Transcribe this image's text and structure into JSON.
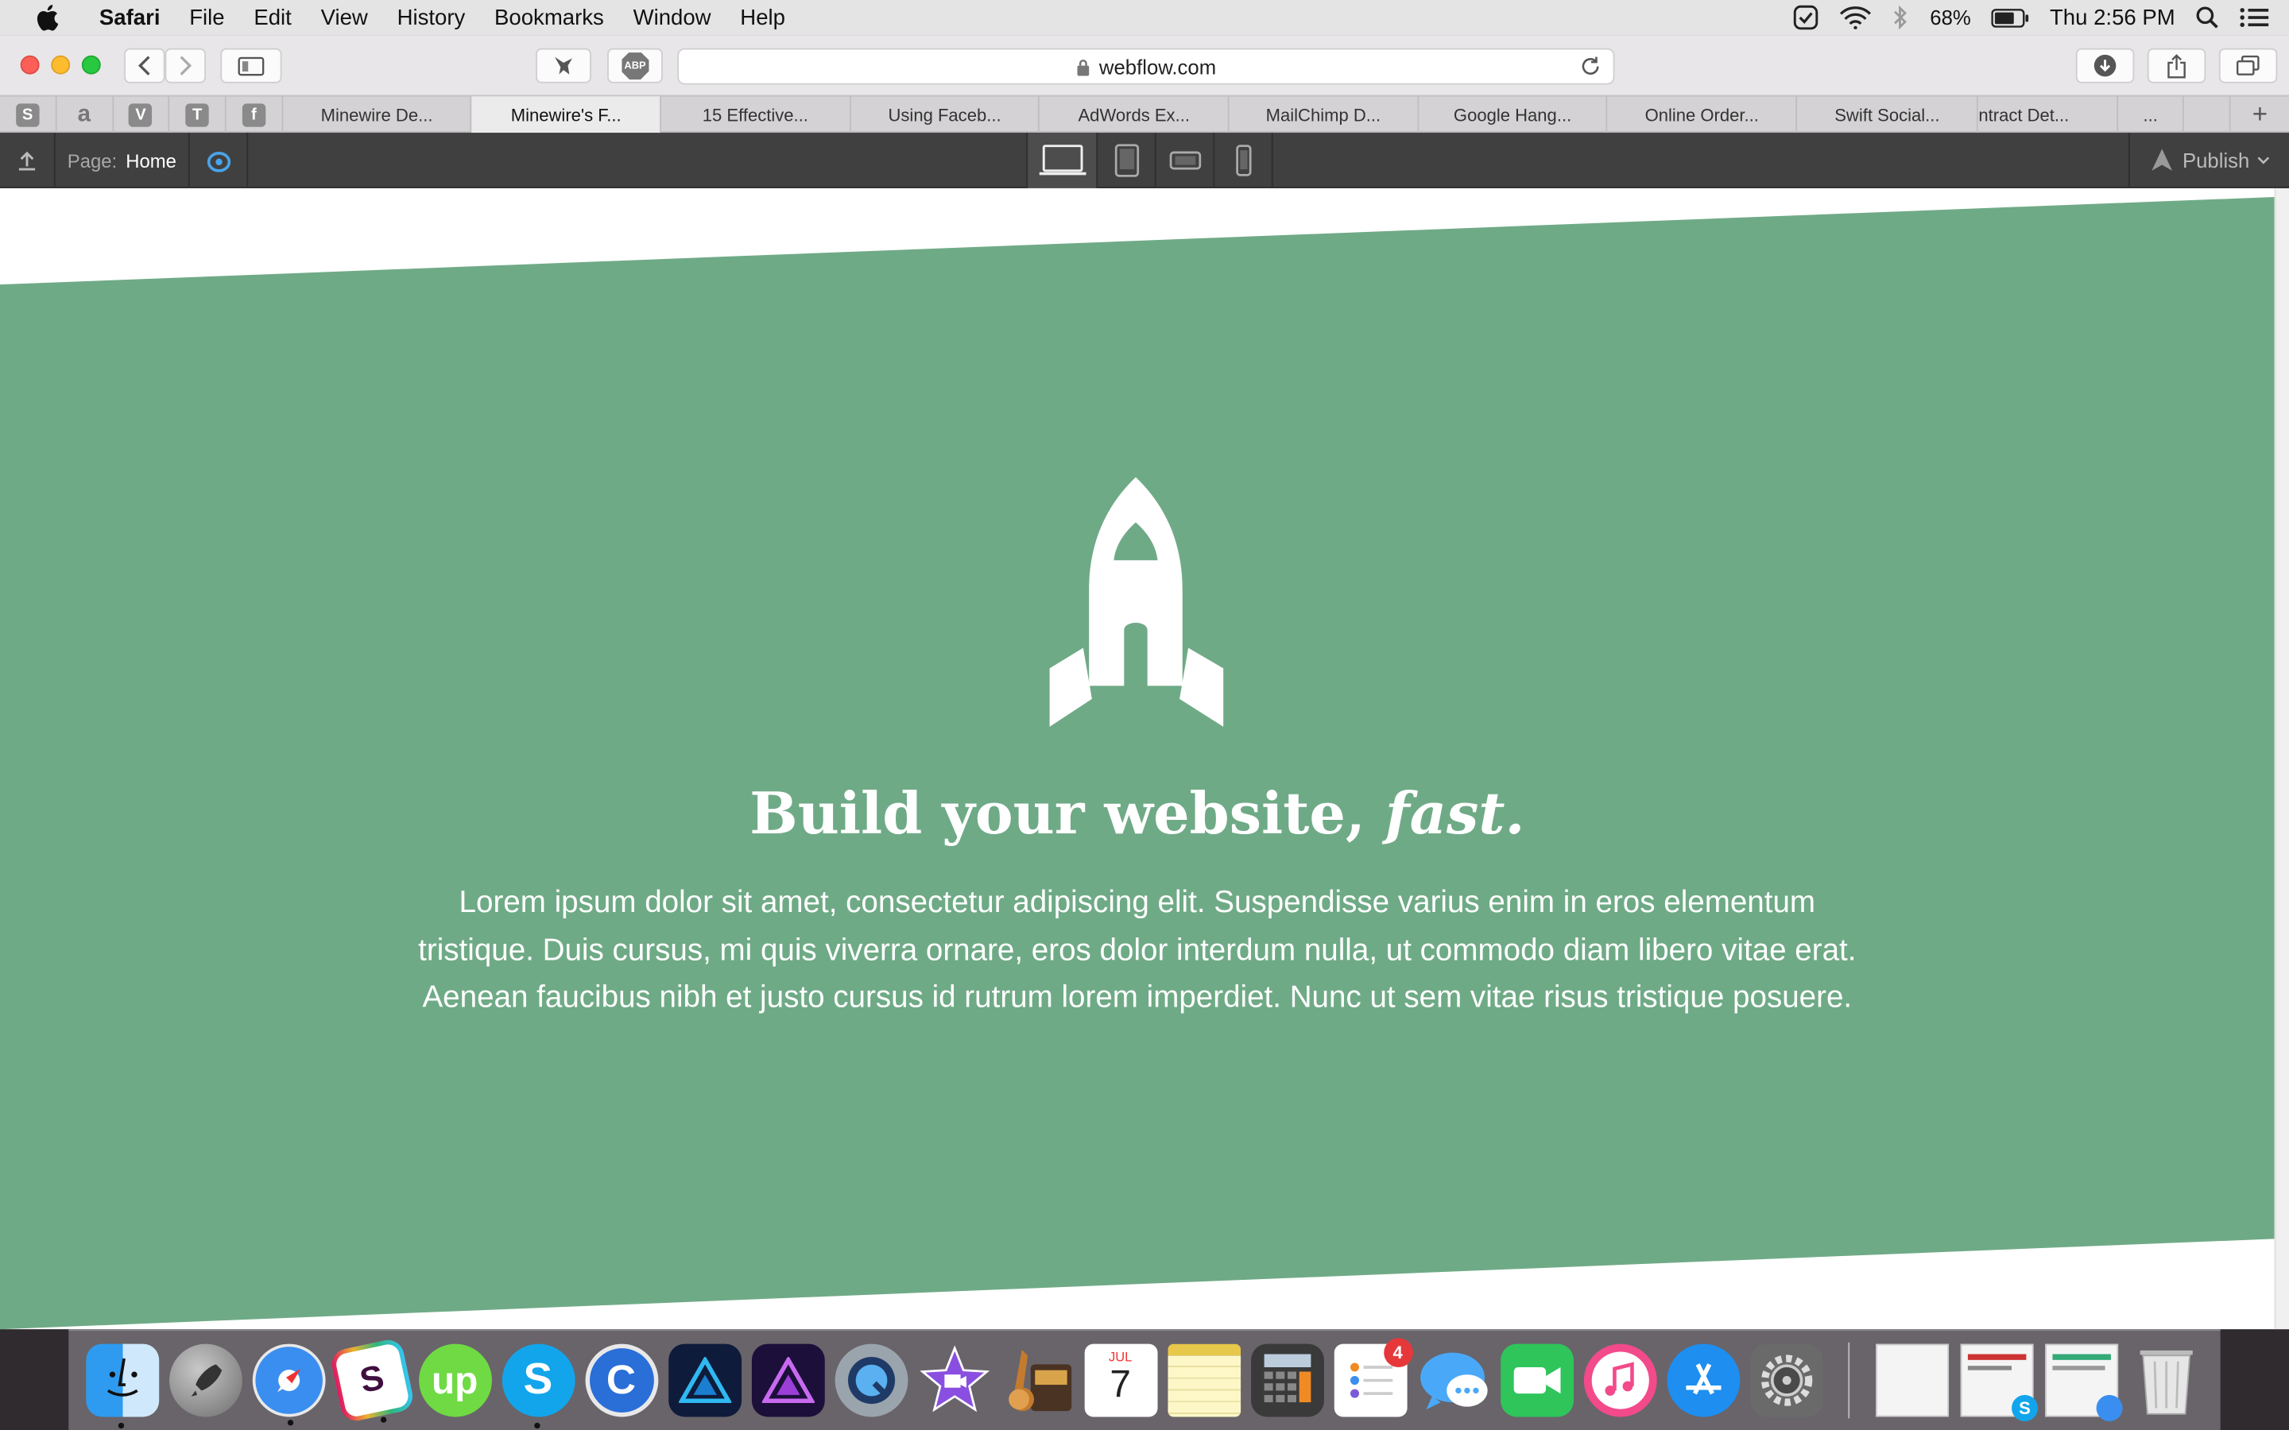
{
  "menubar": {
    "app": "Safari",
    "items": [
      "File",
      "Edit",
      "View",
      "History",
      "Bookmarks",
      "Window",
      "Help"
    ],
    "battery": "68%",
    "clock": "Thu 2:56 PM"
  },
  "toolbar": {
    "url": "webflow.com",
    "abp_label": "ABP"
  },
  "tabs": {
    "pinned": [
      "S",
      "a",
      "V",
      "T",
      "f"
    ],
    "items": [
      "Minewire De...",
      "Minewire's F...",
      "15 Effective...",
      "Using Faceb...",
      "AdWords Ex...",
      "MailChimp D...",
      "Google Hang...",
      "Online Order...",
      "Swift Social...",
      "ntract Det...",
      "..."
    ],
    "add": "+"
  },
  "webflow": {
    "page_label": "Page:",
    "page_name": "Home",
    "publish_label": "Publish"
  },
  "hero": {
    "title": "Build your website,",
    "title_emphasis": "fast.",
    "body": "Lorem ipsum dolor sit amet, consectetur adipiscing elit. Suspendisse varius enim in eros elementum tristique. Duis cursus, mi quis viverra ornare, eros dolor interdum nulla, ut commodo diam libero vitae erat. Aenean faucibus nibh et justo cursus id rutrum lorem imperdiet. Nunc ut sem vitae risus tristique posuere.",
    "color": "#6faa86"
  },
  "dock": {
    "calendar_month": "JUL",
    "calendar_day": "7",
    "reminders_badge": "4",
    "icons": [
      "finder-icon",
      "launchpad-icon",
      "safari-icon",
      "slack-icon",
      "upwork-icon",
      "skype-icon",
      "c-app-icon",
      "affinity-designer-icon",
      "affinity-photo-icon",
      "quicktime-icon",
      "imovie-icon",
      "garageband-icon",
      "calendar-icon",
      "notes-icon",
      "calculator-icon",
      "reminders-icon",
      "messages-icon",
      "facetime-icon",
      "itunes-icon",
      "app-store-icon",
      "system-preferences-icon"
    ]
  }
}
